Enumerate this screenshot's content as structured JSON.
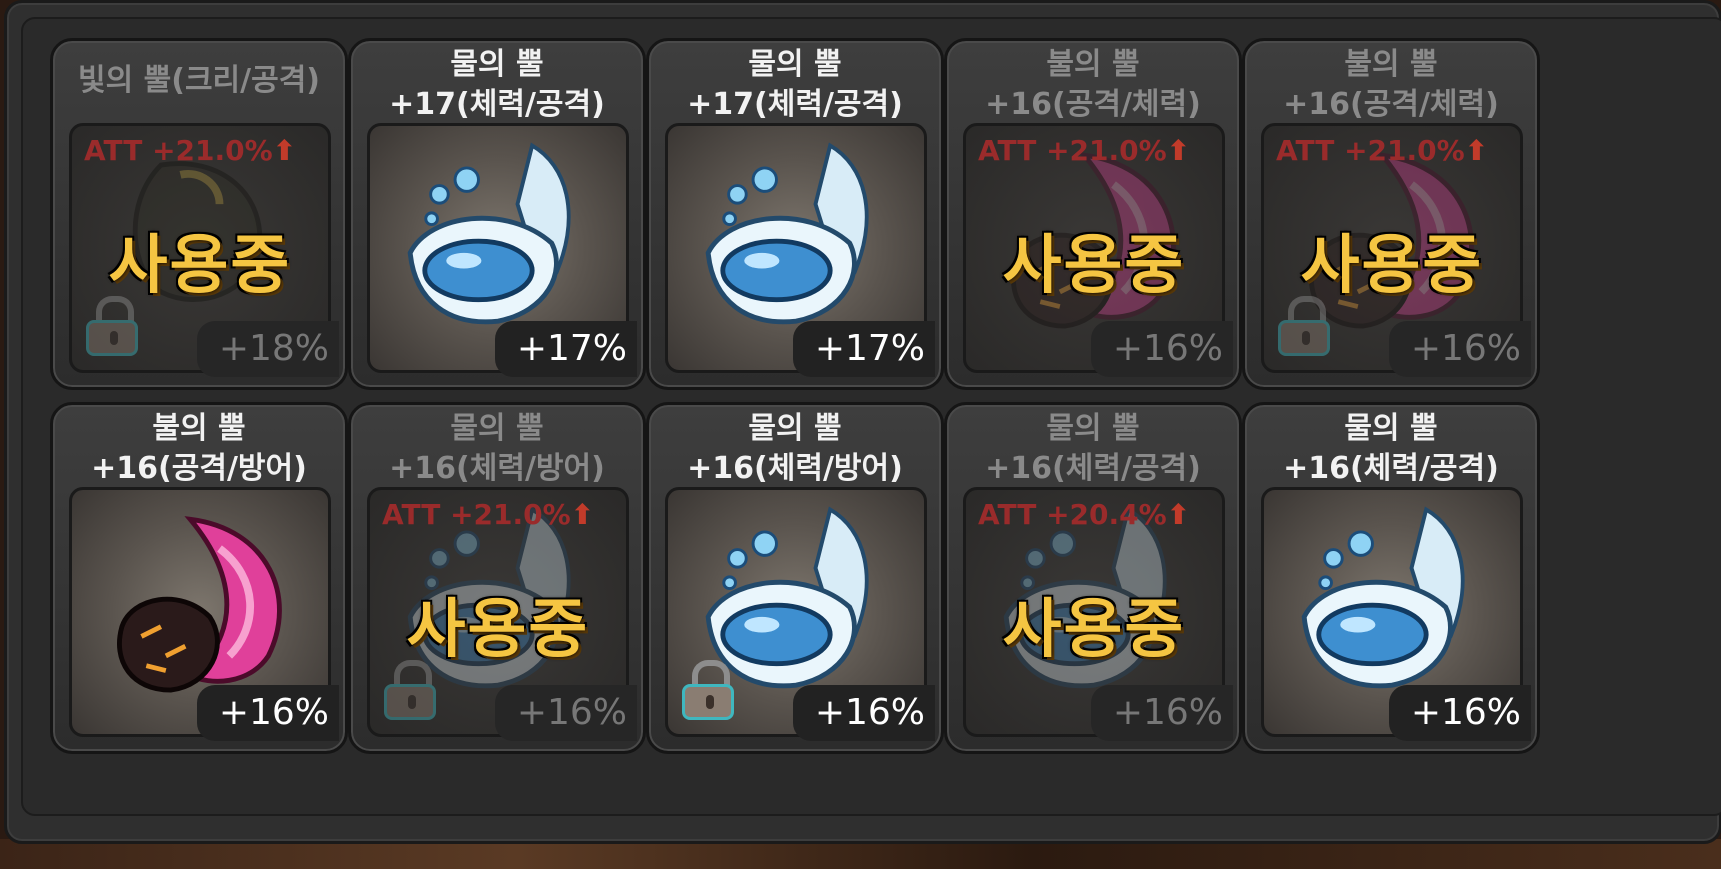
{
  "colors": {
    "in_use_text": "#f5c542",
    "att_text": "#9a2b2b",
    "lock_outline": "#3fb7bf"
  },
  "cards": [
    {
      "name": "빛의 뿔(크리/공격)",
      "percent": "+18%",
      "in_use": true,
      "in_use_label": "사용중",
      "att": "ATT +21.0%",
      "locked": true,
      "icon": "light-horn-icon"
    },
    {
      "name": "물의 뿔\n+17(체력/공격)",
      "percent": "+17%",
      "in_use": false,
      "locked": false,
      "icon": "water-horn-icon"
    },
    {
      "name": "물의 뿔\n+17(체력/공격)",
      "percent": "+17%",
      "in_use": false,
      "locked": false,
      "icon": "water-horn-icon"
    },
    {
      "name": "불의 뿔\n+16(공격/체력)",
      "percent": "+16%",
      "in_use": true,
      "in_use_label": "사용중",
      "att": "ATT +21.0%",
      "locked": false,
      "icon": "fire-horn-icon"
    },
    {
      "name": "불의 뿔\n+16(공격/체력)",
      "percent": "+16%",
      "in_use": true,
      "in_use_label": "사용중",
      "att": "ATT +21.0%",
      "locked": true,
      "icon": "fire-horn-icon"
    },
    {
      "name": "불의 뿔\n+16(공격/방어)",
      "percent": "+16%",
      "in_use": false,
      "locked": false,
      "icon": "fire-horn-icon"
    },
    {
      "name": "물의 뿔\n+16(체력/방어)",
      "percent": "+16%",
      "in_use": true,
      "in_use_label": "사용중",
      "att": "ATT +21.0%",
      "locked": true,
      "icon": "water-horn-icon"
    },
    {
      "name": "물의 뿔\n+16(체력/방어)",
      "percent": "+16%",
      "in_use": false,
      "locked": true,
      "icon": "water-horn-icon"
    },
    {
      "name": "물의 뿔\n+16(체력/공격)",
      "percent": "+16%",
      "in_use": true,
      "in_use_label": "사용중",
      "att": "ATT +20.4%",
      "locked": false,
      "icon": "water-horn-icon"
    },
    {
      "name": "물의 뿔\n+16(체력/공격)",
      "percent": "+16%",
      "in_use": false,
      "locked": false,
      "icon": "water-horn-icon"
    }
  ]
}
